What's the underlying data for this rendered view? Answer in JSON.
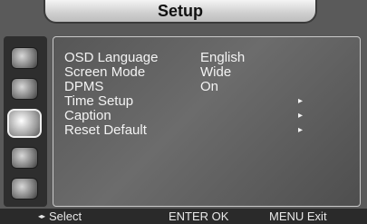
{
  "title": "Setup",
  "menu": {
    "items": [
      {
        "label": "OSD Language",
        "value": "English"
      },
      {
        "label": "Screen Mode",
        "value": "Wide"
      },
      {
        "label": "DPMS",
        "value": "On"
      },
      {
        "label": "Time Setup",
        "arrow": "▸"
      },
      {
        "label": "Caption",
        "arrow": "▸"
      },
      {
        "label": "Reset Default",
        "arrow": "▸"
      }
    ]
  },
  "sidebar": {
    "icons": [
      "picture-icon",
      "audio-icon",
      "setup-icon",
      "lock-icon",
      "channel-icon"
    ],
    "active_index": 2
  },
  "footer": {
    "select_label": "Select",
    "ok_label": "ENTER OK",
    "exit_label": "MENU Exit",
    "nav_icon": "◂▸"
  }
}
